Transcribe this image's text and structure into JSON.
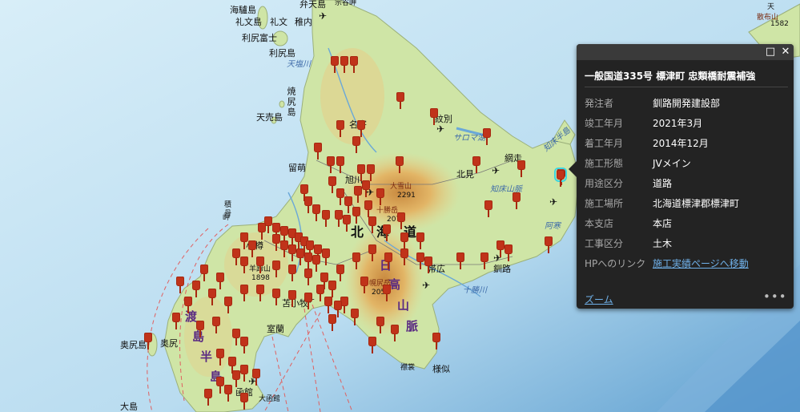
{
  "map": {
    "labels": {
      "wakkanai": "稚内",
      "soya_misaki": "宗谷岬",
      "benten": "弁天島",
      "kaibaru": "海驢島",
      "rebun": "礼文島",
      "rebun_town": "礼文",
      "rishiri_fuji": "利尻富士",
      "rishiri": "利尻島",
      "tenshiokawa": "天塩川",
      "yagishiri": "焼尻島",
      "teuri": "天売島",
      "nayoro": "名寄",
      "monbetsu": "紋別",
      "saroma": "サロマ湖",
      "abashiri": "網走",
      "shiretoko": "知床半島",
      "rumoi": "留萌",
      "asahikawa": "旭川",
      "taisetsu": "大雪山",
      "taisetsu_h": "2291",
      "kitami": "北見",
      "shiretoko_mts": "知床山脈",
      "tokachi": "十勝岳",
      "tokachi_h": "2077",
      "hokkaido1": "北",
      "hokkaido2": "海",
      "hokkaido3": "道",
      "shakotan": "積丹",
      "shakotan2": "岬",
      "otaru": "小樽",
      "yotei": "羊蹄山",
      "yotei_h": "1898",
      "obihiro": "帯広",
      "kushiro": "釧路",
      "akan": "阿寒",
      "nemuro": "根室",
      "hidaka1": "日",
      "hidaka2": "高",
      "hidaka3": "山",
      "hidaka4": "脈",
      "poroshiri": "幌尻岳",
      "poroshiri_h": "2052",
      "tokachigawa": "十勝川",
      "tomakomai": "苫小牧",
      "muroran": "室蘭",
      "erimo": "襟裳岬",
      "erimo2": "襟裳",
      "samani": "様似",
      "okushiri_is": "奥尻島",
      "okushiri": "奥尻",
      "oshima1": "渡",
      "oshima2": "島",
      "oshima3": "半",
      "oshima4": "島",
      "hakodate": "函館",
      "hakodate_mt": "大函館",
      "oshima_is": "大島",
      "kunashiri_h": "1582",
      "kunashiri": "散布山",
      "kunashiri_top": "天"
    }
  },
  "popup": {
    "title": "一般国道335号 標津町 忠類橋耐震補強",
    "controls": {
      "maximize": "□",
      "close": "✕"
    },
    "rows": [
      {
        "key": "発注者",
        "value": "釧路開発建設部"
      },
      {
        "key": "竣工年月",
        "value": "2021年3月"
      },
      {
        "key": "着工年月",
        "value": "2014年12月"
      },
      {
        "key": "施工形態",
        "value": "JVメイン"
      },
      {
        "key": "用途区分",
        "value": "道路"
      },
      {
        "key": "施工場所",
        "value": "北海道標津郡標津町"
      },
      {
        "key": "本支店",
        "value": "本店"
      },
      {
        "key": "工事区分",
        "value": "土木"
      }
    ],
    "link_key": "HPへのリンク",
    "link_text": "施工実績ページへ移動",
    "zoom": "ズーム",
    "more": "•••"
  },
  "colors": {
    "sea": "#bfe0f2",
    "land": "#cfe5a6",
    "pin": "#c0331a",
    "popup_bg": "#232323",
    "link": "#6fb0e8"
  }
}
